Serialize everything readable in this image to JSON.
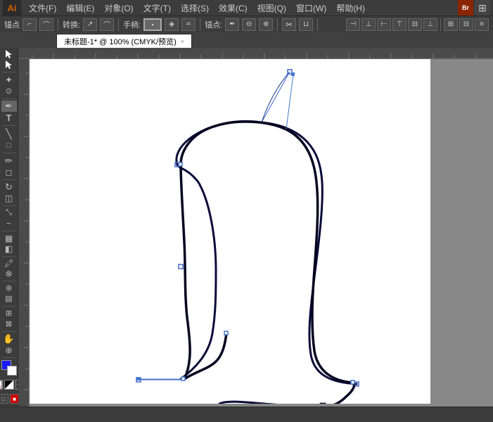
{
  "app": {
    "logo": "Ai",
    "title": "Adobe Illustrator"
  },
  "menu": {
    "items": [
      "文件(F)",
      "编辑(E)",
      "对象(O)",
      "文字(T)",
      "选择(S)",
      "效果(C)",
      "视图(Q)",
      "窗口(W)",
      "帮助(H)"
    ]
  },
  "options_bar": {
    "label_anchor": "锚点",
    "label_transform": "转换:",
    "label_handle": "手柄:",
    "label_anchor2": "锚点:"
  },
  "tab": {
    "title": "未标题-1*",
    "zoom": "100%",
    "colormode": "CMYK/预览",
    "close": "×"
  },
  "tools": [
    {
      "name": "selection-tool",
      "icon": "▸",
      "active": false
    },
    {
      "name": "direct-selection-tool",
      "icon": "▹",
      "active": false
    },
    {
      "name": "magic-wand-tool",
      "icon": "✦",
      "active": false
    },
    {
      "name": "lasso-tool",
      "icon": "⊙",
      "active": false
    },
    {
      "name": "pen-tool",
      "icon": "✒",
      "active": true
    },
    {
      "name": "type-tool",
      "icon": "T",
      "active": false
    },
    {
      "name": "line-tool",
      "icon": "╲",
      "active": false
    },
    {
      "name": "rect-tool",
      "icon": "□",
      "active": false
    },
    {
      "name": "pencil-tool",
      "icon": "✏",
      "active": false
    },
    {
      "name": "rotate-tool",
      "icon": "↻",
      "active": false
    },
    {
      "name": "mirror-tool",
      "icon": "◫",
      "active": false
    },
    {
      "name": "scale-tool",
      "icon": "⤡",
      "active": false
    },
    {
      "name": "warp-tool",
      "icon": "~",
      "active": false
    },
    {
      "name": "graph-tool",
      "icon": "▦",
      "active": false
    },
    {
      "name": "gradient-tool",
      "icon": "◧",
      "active": false
    },
    {
      "name": "eyedropper-tool",
      "icon": "🖍",
      "active": false
    },
    {
      "name": "blend-tool",
      "icon": "⊗",
      "active": false
    },
    {
      "name": "symbol-tool",
      "icon": "⊛",
      "active": false
    },
    {
      "name": "column-graph-tool",
      "icon": "▤",
      "active": false
    },
    {
      "name": "artboard-tool",
      "icon": "⊞",
      "active": false
    },
    {
      "name": "slice-tool",
      "icon": "⊠",
      "active": false
    },
    {
      "name": "hand-tool",
      "icon": "✋",
      "active": false
    },
    {
      "name": "zoom-tool",
      "icon": "🔍",
      "active": false
    }
  ],
  "colors": {
    "foreground": "#ff0000",
    "background": "#ffffff",
    "accent": "#003b9e"
  },
  "status": {
    "text": ""
  }
}
